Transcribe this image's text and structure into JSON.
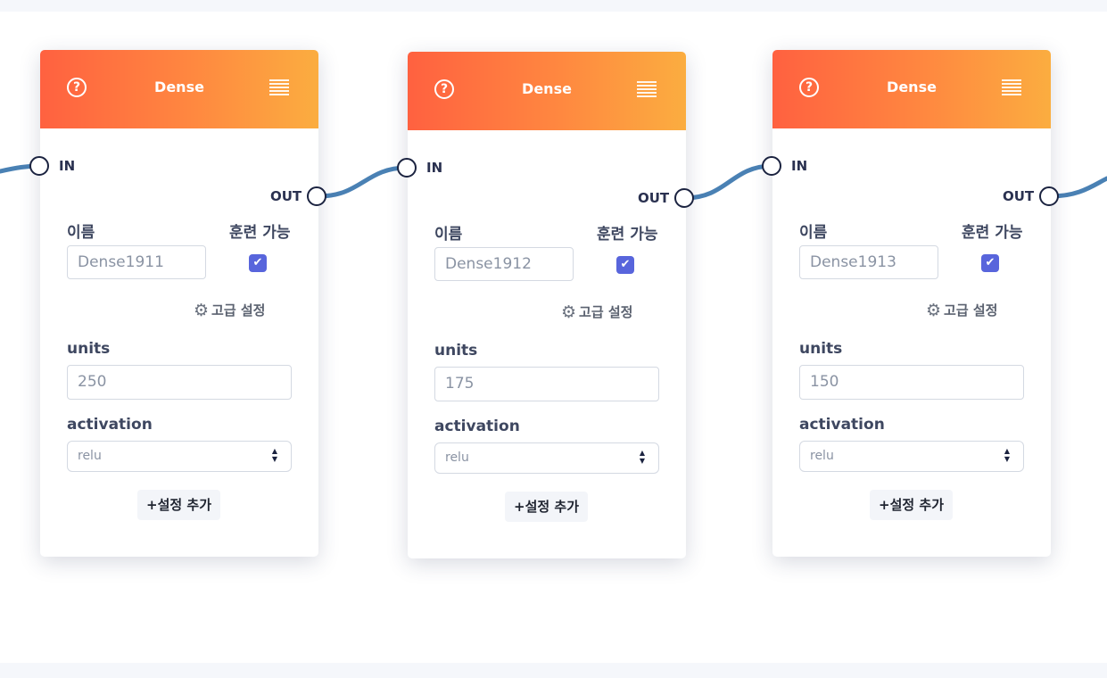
{
  "nodes": [
    {
      "title": "Dense",
      "in_label": "IN",
      "out_label": "OUT",
      "name_label": "이름",
      "name_value": "Dense1911",
      "trainable_label": "훈련 가능",
      "trainable_checked": true,
      "advanced_label": "고급 설정",
      "units_label": "units",
      "units_value": "250",
      "activation_label": "activation",
      "activation_value": "relu",
      "add_setting_label": "+설정 추가"
    },
    {
      "title": "Dense",
      "in_label": "IN",
      "out_label": "OUT",
      "name_label": "이름",
      "name_value": "Dense1912",
      "trainable_label": "훈련 가능",
      "trainable_checked": true,
      "advanced_label": "고급 설정",
      "units_label": "units",
      "units_value": "175",
      "activation_label": "activation",
      "activation_value": "relu",
      "add_setting_label": "+설정 추가"
    },
    {
      "title": "Dense",
      "in_label": "IN",
      "out_label": "OUT",
      "name_label": "이름",
      "name_value": "Dense1913",
      "trainable_label": "훈련 가능",
      "trainable_checked": true,
      "advanced_label": "고급 설정",
      "units_label": "units",
      "units_value": "150",
      "activation_label": "activation",
      "activation_value": "relu",
      "add_setting_label": "+설정 추가"
    }
  ],
  "colors": {
    "header_gradient_start": "#ff6140",
    "header_gradient_end": "#fbad40",
    "wire": "#4a81b4",
    "checkbox": "#5865dc"
  },
  "icons": {
    "help": "help-icon",
    "menu": "menu-icon",
    "gear": "gear-icon",
    "checkbox": "checkmark-icon",
    "select": "sort-icon"
  }
}
